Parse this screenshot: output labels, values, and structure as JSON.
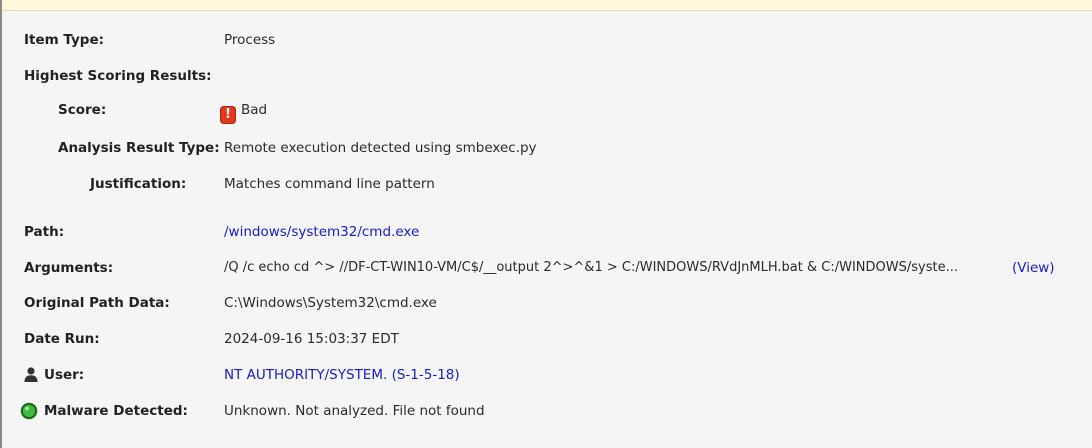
{
  "rows": {
    "item_type": {
      "label": "Item Type:",
      "value": "Process"
    },
    "highest": {
      "label": "Highest Scoring Results:"
    },
    "score": {
      "label": "Score:",
      "value": "Bad",
      "icon": "bad-exclamation-icon"
    },
    "analysis": {
      "label": "Analysis Result Type:",
      "value": "Remote execution detected using smbexec.py"
    },
    "justification": {
      "label": "Justification:",
      "value": "Matches command line pattern"
    },
    "path": {
      "label": "Path:",
      "value": "/windows/system32/cmd.exe"
    },
    "arguments": {
      "label": "Arguments:",
      "value": "/Q /c echo cd ^> //DF-CT-WIN10-VM/C$/__output 2^>^&1 > C:/WINDOWS/RVdJnMLH.bat & C:/WINDOWS/syste...",
      "view_label": "(View)"
    },
    "original_path": {
      "label": "Original Path Data:",
      "value": "C:\\Windows\\System32\\cmd.exe"
    },
    "date_run": {
      "label": "Date Run:",
      "value": "2024-09-16 15:03:37 EDT"
    },
    "user": {
      "label": "User:",
      "value": "NT AUTHORITY/SYSTEM. (S-1-5-18)",
      "icon": "user-icon"
    },
    "malware": {
      "label": "Malware Detected:",
      "value": "Unknown. Not analyzed. File not found",
      "icon": "green-status-icon"
    }
  },
  "colors": {
    "link": "#1a1ad6",
    "banner": "#fff8dc",
    "bad": "#e0391e",
    "ok": "#2e9e2e"
  }
}
